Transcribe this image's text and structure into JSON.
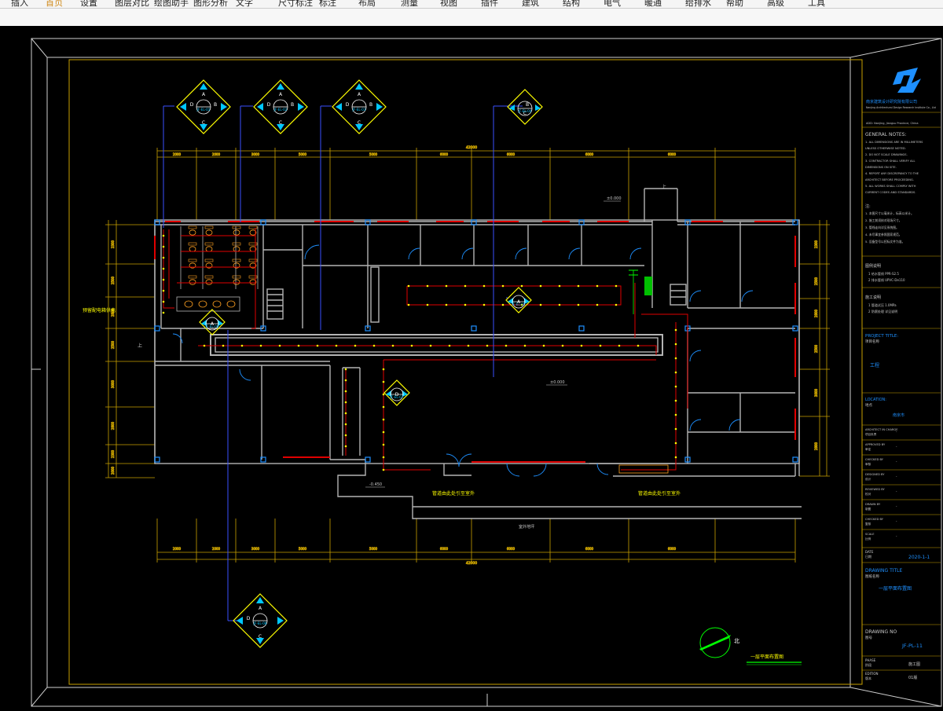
{
  "menu": {
    "items": [
      "插入",
      "首页",
      "设置",
      "图层对比",
      "绘图助手",
      "图形分析",
      "文字",
      "尺寸标注",
      "标注",
      "布局",
      "测量",
      "视图",
      "插件",
      "建筑",
      "结构",
      "电气",
      "暖通",
      "给排水",
      "帮助",
      "高级",
      "工具"
    ],
    "active_index": 1
  },
  "colors": {
    "background": "#000000",
    "frame_yellow": "#c8a000",
    "wall_grey": "#b4b4b4",
    "pipe_red": "#e00000",
    "accent_blue": "#1e90ff",
    "symbol_yellow": "#ffff00",
    "symbol_cyan": "#00c8ff",
    "text_green": "#00ff00"
  },
  "drawing": {
    "callouts": [
      {
        "top": "A",
        "left": "D",
        "right": "B",
        "bottom": "C",
        "code": "JF-EL-01"
      },
      {
        "top": "A",
        "left": "D",
        "right": "B",
        "bottom": "C",
        "code": "JF-EL-02"
      },
      {
        "top": "A",
        "left": "D",
        "right": "B",
        "bottom": "C",
        "code": "JF-EL-03"
      },
      {
        "top": "",
        "left": "",
        "right": "B",
        "bottom": "C",
        "code": "JF-EL-04"
      },
      {
        "top": "A",
        "left": "",
        "right": "",
        "bottom": "",
        "code": "JF-EL-05"
      },
      {
        "top": "A",
        "left": "",
        "right": "",
        "bottom": "",
        "code": "JF-EL-06"
      },
      {
        "top": "D",
        "left": "",
        "right": "",
        "bottom": "",
        "code": "JF-EL-07"
      },
      {
        "top": "A",
        "left": "D",
        "right": "",
        "bottom": "C",
        "code": "JF-EL-08"
      }
    ],
    "dim_top_total": "42000",
    "dim_bottom_total": "42000",
    "dims_top": [
      "2000",
      "2000",
      "3000",
      "5000",
      "5000",
      "6000",
      "6000",
      "6000",
      "6000"
    ],
    "dims_bottom": [
      "2000",
      "2000",
      "3000",
      "5000",
      "5000",
      "6000",
      "6000",
      "6000",
      "6000"
    ],
    "dims_left": [
      "2300",
      "2500",
      "2800",
      "2500",
      "3000",
      "2800",
      "2300",
      "2000"
    ],
    "dims_right": [
      "2300",
      "2500",
      "2800",
      "2500",
      "3000",
      "2800"
    ],
    "labels": {
      "left_note": "预留配电箱供电",
      "stair_up": "上",
      "level_top": "±0.000",
      "level_mid": "±0.000",
      "level_bottom": "-0.450",
      "note_bottom_left": "管道由此处引至室外",
      "note_bottom_right": "管道由此处引至室外",
      "bottom_ground": "室外地坪",
      "north_text": "北",
      "plan_title": "一层平面布置图"
    }
  },
  "title_block": {
    "company_cn": "南京建筑设计研究院有限公司",
    "company_en": "Nanjing Architectural Design Research Institute Co., Ltd",
    "address": "ADD: Nanjing, Jiangsu Province, China",
    "general_notes_title": "GENERAL NOTES:",
    "general_notes": [
      "1. ALL DIMENSIONS ARE IN MILLIMETERS",
      "   UNLESS OTHERWISE NOTED.",
      "2. DO NOT SCALE DRAWINGS.",
      "3. CONTRACTOR SHALL VERIFY ALL",
      "   DIMENSIONS ON SITE.",
      "4. REPORT ANY DISCREPANCY TO THE",
      "   ARCHITECT BEFORE PROCEEDING.",
      "5. ALL WORKS SHALL COMPLY WITH",
      "   CURRENT CODES AND STANDARDS."
    ],
    "cn_notes_title": "注:",
    "cn_notes": [
      "1. 本图尺寸以毫米计，标高以米计。",
      "2. 施工前须核对现场尺寸。",
      "3. 管线走向详见系统图。",
      "4. 未尽事宜参照国家规范。",
      "5. 设备型号以招标文件为准。"
    ],
    "legend1_title": "图例说明",
    "legend1": [
      "1  给水管线   PPR-S2.5",
      "2  排水管线   UPVC-De110"
    ],
    "legend2_title": "施工说明",
    "legend2": [
      "1  管道试压   1.0MPa",
      "2  防腐处理   详见说明"
    ],
    "project_title_label": "PROJECT TITLE:",
    "project_title_cn": "项目名称",
    "project_name": "工程",
    "location_label": "LOCATION:",
    "location_cn": "地点",
    "location_value": "南京市",
    "rows": [
      {
        "en": "ARCHITECT IN CHARGE",
        "cn": "项目负责",
        "val": "-"
      },
      {
        "en": "APPROVED BY",
        "cn": "审定",
        "val": "-"
      },
      {
        "en": "CHECKED BY",
        "cn": "审核",
        "val": "-"
      },
      {
        "en": "DESIGNED BY",
        "cn": "设计",
        "val": "-"
      },
      {
        "en": "REVIEWED BY",
        "cn": "校对",
        "val": "-"
      },
      {
        "en": "DRAWN BY",
        "cn": "制图",
        "val": "-"
      },
      {
        "en": "CHECKED BY",
        "cn": "复核",
        "val": "-"
      },
      {
        "en": "SCALE",
        "cn": "比例",
        "val": "-"
      }
    ],
    "date_label": "DATE",
    "date_cn": "日期",
    "date_value": "2020-1-1",
    "drawing_title_label": "DRAWING TITLE",
    "drawing_title_cn": "图纸名称",
    "drawing_title_value": "一层平面布置图",
    "drawing_no_label": "DRAWING NO",
    "drawing_no_cn": "图号",
    "drawing_no_value": "JF-PL-11",
    "phase_label": "PHASE",
    "phase_cn": "阶段",
    "phase_value": "施工图",
    "edition_label": "EDITION",
    "edition_cn": "版本",
    "edition_value": "01版"
  }
}
